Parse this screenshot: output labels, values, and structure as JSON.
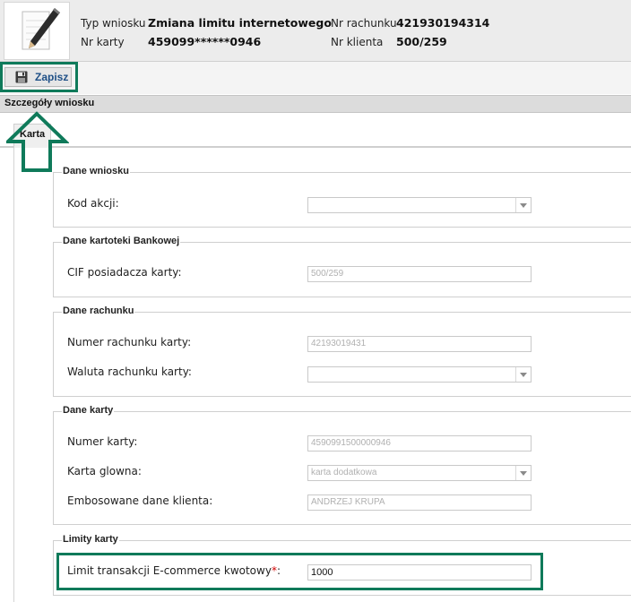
{
  "header": {
    "type_label": "Typ wniosku",
    "type_value": "Zmiana limitu internetowego",
    "card_label": "Nr karty",
    "card_value": "459099******0946",
    "account_label": "Nr rachunku",
    "account_value": "421930194314",
    "client_label": "Nr klienta",
    "client_value": "500/259",
    "icon": "pencil-notepad-icon"
  },
  "toolbar": {
    "save_label": "Zapisz",
    "save_icon": "floppy-disk-icon"
  },
  "section": {
    "title": "Szczegóły wniosku"
  },
  "tabs": [
    {
      "label": "Karta"
    }
  ],
  "fieldsets": {
    "dane_wniosku": {
      "legend": "Dane wniosku",
      "kod_akcji": {
        "label": "Kod akcji:",
        "value": ""
      }
    },
    "dane_kartoteki": {
      "legend": "Dane kartoteki Bankowej",
      "cif": {
        "label": "CIF posiadacza karty:",
        "value": "500/259"
      }
    },
    "dane_rachunku": {
      "legend": "Dane rachunku",
      "numer": {
        "label": "Numer rachunku karty:",
        "value": "42193019431"
      },
      "waluta": {
        "label": "Waluta rachunku karty:",
        "value": ""
      }
    },
    "dane_karty": {
      "legend": "Dane karty",
      "numer": {
        "label": "Numer karty:",
        "value": "4590991500000946"
      },
      "glowna": {
        "label": "Karta glowna:",
        "value": "karta dodatkowa"
      },
      "embos": {
        "label": "Embosowane dane klienta:",
        "value": "ANDRZEJ KRUPA"
      }
    },
    "limity_karty": {
      "legend": "Limity karty",
      "limit": {
        "label": "Limit transakcji E-commerce kwotowy",
        "required_mark": "*",
        "colon": ":",
        "value": "1000"
      }
    }
  },
  "colors": {
    "highlight": "#0f7a5a",
    "header_bg": "#ececec",
    "required": "#d00000",
    "save_text": "#1e4f86"
  }
}
